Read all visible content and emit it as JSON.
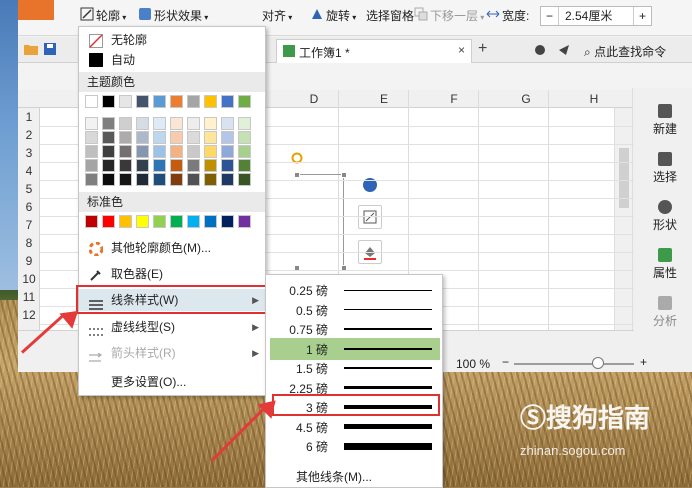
{
  "toolbar": {
    "outline_label": "轮廓",
    "shape_effects_label": "形状效果",
    "align_label": "对齐",
    "rotate_label": "旋转",
    "selection_pane_label": "选择窗格",
    "send_backward_label": "下移一层",
    "width_label": "宽度:",
    "width_value": "2.54厘米",
    "minus": "−",
    "plus": "+"
  },
  "tabs": {
    "doc_title": "工作簿1 *",
    "close": "×",
    "add": "+",
    "search_command": "点此查找命令"
  },
  "grid": {
    "columns": [
      "D",
      "E",
      "F",
      "G",
      "H"
    ],
    "rows": [
      "1",
      "2",
      "3",
      "4",
      "5",
      "6",
      "7",
      "8",
      "9",
      "10",
      "11",
      "12"
    ]
  },
  "right_panel": {
    "items": [
      {
        "label": "新建"
      },
      {
        "label": "选择"
      },
      {
        "label": "形状"
      },
      {
        "label": "属性"
      },
      {
        "label": "分析"
      }
    ]
  },
  "status": {
    "zoom": "100 %",
    "minus": "−",
    "plus": "+"
  },
  "outline_menu": {
    "no_outline": "无轮廓",
    "auto": "自动",
    "theme_colors_header": "主题颜色",
    "standard_colors_header": "标准色",
    "more_colors": "其他轮廓颜色(M)...",
    "eyedropper": "取色器(E)",
    "line_style": "线条样式(W)",
    "dash_type": "虚线线型(S)",
    "arrow_style": "箭头样式(R)",
    "more_settings": "更多设置(O)...",
    "theme_colors_top": [
      "#ffffff",
      "#000000",
      "#e7e6e6",
      "#44546a",
      "#5b9bd5",
      "#ed7d31",
      "#a5a5a5",
      "#ffc000",
      "#4472c4",
      "#70ad47"
    ],
    "theme_shades": [
      [
        "#f2f2f2",
        "#7f7f7f",
        "#d0cece",
        "#d6dce4",
        "#deebf6",
        "#fbe5d5",
        "#ededed",
        "#fff2cc",
        "#d9e2f3",
        "#e2efd9"
      ],
      [
        "#d8d8d8",
        "#595959",
        "#aeabab",
        "#adb9ca",
        "#bdd7ee",
        "#f7cbac",
        "#dbdbdb",
        "#fee599",
        "#b4c6e7",
        "#c5e0b3"
      ],
      [
        "#bfbfbf",
        "#3f3f3f",
        "#757070",
        "#8496b0",
        "#9cc3e5",
        "#f4b183",
        "#c9c9c9",
        "#ffd965",
        "#8eaadb",
        "#a8d08d"
      ],
      [
        "#a5a5a5",
        "#262626",
        "#3a3838",
        "#323f4f",
        "#2e75b5",
        "#c55a11",
        "#7b7b7b",
        "#bf9000",
        "#2f5496",
        "#538135"
      ],
      [
        "#7f7f7f",
        "#0c0c0c",
        "#171616",
        "#222a35",
        "#1e4e79",
        "#833c0b",
        "#525252",
        "#7f6000",
        "#1f3864",
        "#375623"
      ]
    ],
    "standard_colors": [
      "#c00000",
      "#ff0000",
      "#ffc000",
      "#ffff00",
      "#92d050",
      "#00b050",
      "#00b0f0",
      "#0070c0",
      "#002060",
      "#7030a0"
    ]
  },
  "line_style_menu": {
    "weights": [
      {
        "label": "0.25 磅"
      },
      {
        "label": "0.5 磅"
      },
      {
        "label": "0.75 磅"
      },
      {
        "label": "1 磅"
      },
      {
        "label": "1.5 磅"
      },
      {
        "label": "2.25 磅"
      },
      {
        "label": "3 磅"
      },
      {
        "label": "4.5 磅"
      },
      {
        "label": "6 磅"
      }
    ],
    "more_lines": "其他线条(M)..."
  },
  "watermark": {
    "brand": "搜狗指南",
    "url": "zhinan.sogou.com"
  }
}
